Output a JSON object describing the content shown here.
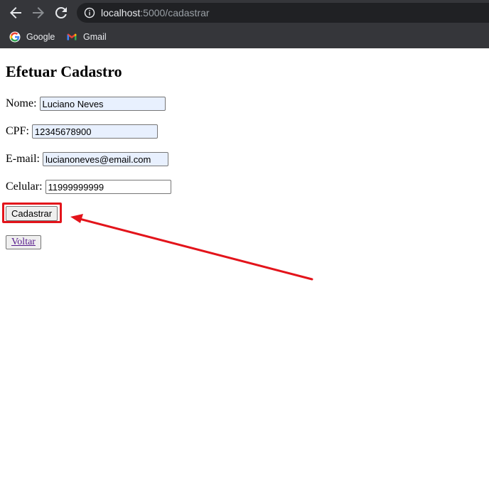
{
  "browser": {
    "url_host": "localhost",
    "url_path": ":5000/cadastrar",
    "bookmarks": [
      {
        "label": "Google",
        "icon": "google-icon"
      },
      {
        "label": "Gmail",
        "icon": "gmail-icon"
      }
    ],
    "colors": {
      "chrome": "#35363a",
      "omnibox": "#202124"
    }
  },
  "form": {
    "title": "Efetuar Cadastro",
    "fields": {
      "nome": {
        "label": "Nome:",
        "value": "Luciano Neves"
      },
      "cpf": {
        "label": "CPF:",
        "value": "12345678900"
      },
      "email": {
        "label": "E-mail:",
        "value": "lucianoneves@email.com"
      },
      "celular": {
        "label": "Celular:",
        "value": "11999999999"
      }
    },
    "submit_label": "Cadastrar",
    "back_label": "Voltar"
  },
  "annotation": {
    "color": "#e3141b",
    "target": "Cadastrar"
  }
}
